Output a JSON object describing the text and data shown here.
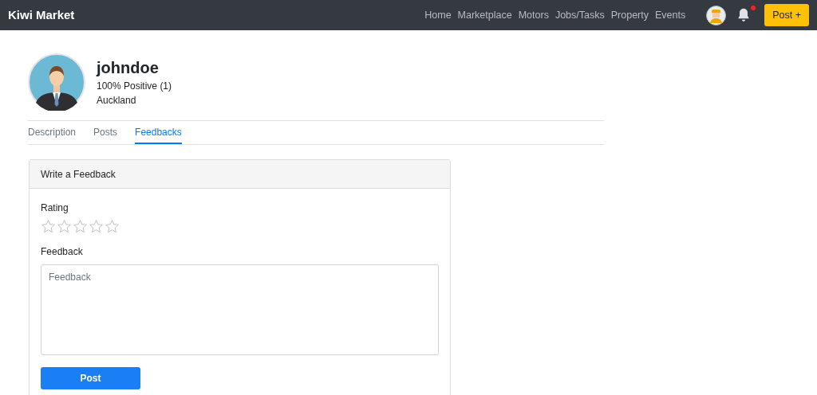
{
  "navbar": {
    "brand": "Kiwi Market",
    "links": [
      "Home",
      "Marketplace",
      "Motors",
      "Jobs/Tasks",
      "Property",
      "Events"
    ],
    "post_button": "Post +"
  },
  "profile": {
    "username": "johndoe",
    "rating": "100% Positive (1)",
    "location": "Auckland"
  },
  "tabs": [
    {
      "label": "Description",
      "selected": false
    },
    {
      "label": "Posts",
      "selected": false
    },
    {
      "label": "Feedbacks",
      "selected": true
    }
  ],
  "feedback_form": {
    "title": "Write a Feedback",
    "rating_label": "Rating",
    "stars": 0,
    "feedback_label": "Feedback",
    "feedback_placeholder": "Feedback",
    "submit": "Post"
  }
}
